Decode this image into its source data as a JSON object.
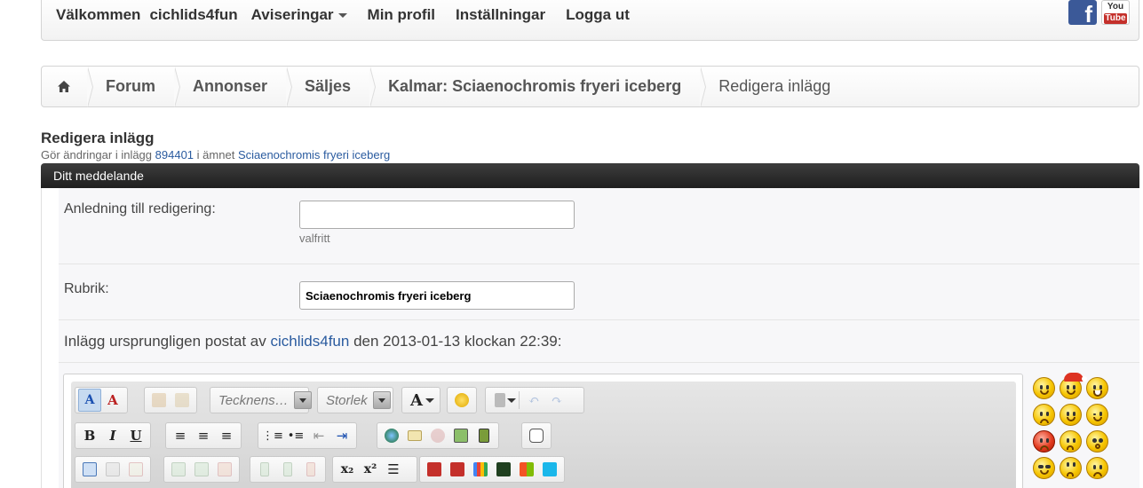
{
  "topnav": {
    "welcome": "Välkommen",
    "username": "cichlids4fun",
    "notifications": "Aviseringar",
    "profile": "Min profil",
    "settings": "Inställningar",
    "logout": "Logga ut",
    "facebook_icon": "facebook-icon",
    "youtube_icon": "youtube-icon",
    "youtube_text_top": "You",
    "youtube_text_bottom": "Tube",
    "facebook_letter": "f"
  },
  "breadcrumb": {
    "home_icon": "home-icon",
    "items": [
      "Forum",
      "Annonser",
      "Säljes",
      "Kalmar: Sciaenochromis fryeri iceberg"
    ],
    "current": "Redigera inlägg"
  },
  "page": {
    "title": "Redigera inlägg",
    "subtitle_prefix": "Gör ändringar i inlägg",
    "post_id": "894401",
    "subtitle_middle": "i ämnet",
    "topic": "Sciaenochromis fryeri iceberg"
  },
  "panel": {
    "header": "Ditt meddelande",
    "reason_label": "Anledning till redigering:",
    "reason_value": "",
    "reason_hint": "valfritt",
    "subject_label": "Rubrik:",
    "subject_value": "Sciaenochromis fryeri iceberg",
    "posted_prefix": "Inlägg ursprungligen postat av",
    "posted_author": "cichlids4fun",
    "posted_suffix": "den 2013-01-13 klockan 22:39:"
  },
  "editor": {
    "font_placeholder": "Tecknens…",
    "size_placeholder": "Storlek",
    "font_color_label": "A",
    "bold": "B",
    "italic": "I",
    "underline": "U",
    "subscript": "x₂",
    "superscript": "x²"
  },
  "colors": {
    "link": "#2a5b9f",
    "panel_header": "#2b2b2b",
    "row_bg": "#f7f7f9"
  }
}
